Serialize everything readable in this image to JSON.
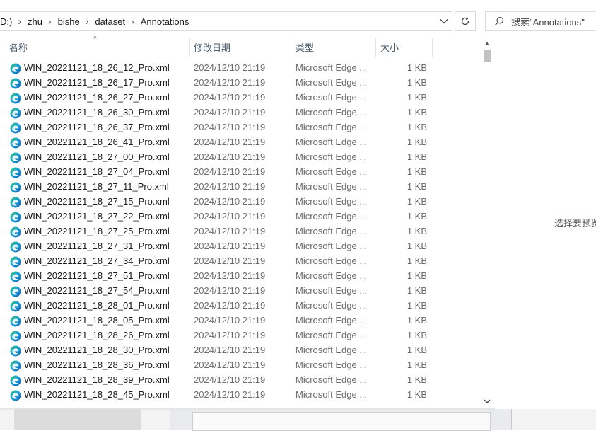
{
  "breadcrumb": {
    "drive_fragment": "D:)",
    "items": [
      "zhu",
      "bishe",
      "dataset",
      "Annotations"
    ]
  },
  "search": {
    "placeholder": "搜索\"Annotations\""
  },
  "columns": {
    "name": "名称",
    "date": "修改日期",
    "type": "类型",
    "size": "大小"
  },
  "files": [
    {
      "name": "WIN_20221121_18_26_12_Pro.xml",
      "date": "2024/12/10 21:19",
      "type": "Microsoft Edge ...",
      "size": "1 KB"
    },
    {
      "name": "WIN_20221121_18_26_17_Pro.xml",
      "date": "2024/12/10 21:19",
      "type": "Microsoft Edge ...",
      "size": "1 KB"
    },
    {
      "name": "WIN_20221121_18_26_27_Pro.xml",
      "date": "2024/12/10 21:19",
      "type": "Microsoft Edge ...",
      "size": "1 KB"
    },
    {
      "name": "WIN_20221121_18_26_30_Pro.xml",
      "date": "2024/12/10 21:19",
      "type": "Microsoft Edge ...",
      "size": "1 KB"
    },
    {
      "name": "WIN_20221121_18_26_37_Pro.xml",
      "date": "2024/12/10 21:19",
      "type": "Microsoft Edge ...",
      "size": "1 KB"
    },
    {
      "name": "WIN_20221121_18_26_41_Pro.xml",
      "date": "2024/12/10 21:19",
      "type": "Microsoft Edge ...",
      "size": "1 KB"
    },
    {
      "name": "WIN_20221121_18_27_00_Pro.xml",
      "date": "2024/12/10 21:19",
      "type": "Microsoft Edge ...",
      "size": "1 KB"
    },
    {
      "name": "WIN_20221121_18_27_04_Pro.xml",
      "date": "2024/12/10 21:19",
      "type": "Microsoft Edge ...",
      "size": "1 KB"
    },
    {
      "name": "WIN_20221121_18_27_11_Pro.xml",
      "date": "2024/12/10 21:19",
      "type": "Microsoft Edge ...",
      "size": "1 KB"
    },
    {
      "name": "WIN_20221121_18_27_15_Pro.xml",
      "date": "2024/12/10 21:19",
      "type": "Microsoft Edge ...",
      "size": "1 KB"
    },
    {
      "name": "WIN_20221121_18_27_22_Pro.xml",
      "date": "2024/12/10 21:19",
      "type": "Microsoft Edge ...",
      "size": "1 KB"
    },
    {
      "name": "WIN_20221121_18_27_25_Pro.xml",
      "date": "2024/12/10 21:19",
      "type": "Microsoft Edge ...",
      "size": "1 KB"
    },
    {
      "name": "WIN_20221121_18_27_31_Pro.xml",
      "date": "2024/12/10 21:19",
      "type": "Microsoft Edge ...",
      "size": "1 KB"
    },
    {
      "name": "WIN_20221121_18_27_34_Pro.xml",
      "date": "2024/12/10 21:19",
      "type": "Microsoft Edge ...",
      "size": "1 KB"
    },
    {
      "name": "WIN_20221121_18_27_51_Pro.xml",
      "date": "2024/12/10 21:19",
      "type": "Microsoft Edge ...",
      "size": "1 KB"
    },
    {
      "name": "WIN_20221121_18_27_54_Pro.xml",
      "date": "2024/12/10 21:19",
      "type": "Microsoft Edge ...",
      "size": "1 KB"
    },
    {
      "name": "WIN_20221121_18_28_01_Pro.xml",
      "date": "2024/12/10 21:19",
      "type": "Microsoft Edge ...",
      "size": "1 KB"
    },
    {
      "name": "WIN_20221121_18_28_05_Pro.xml",
      "date": "2024/12/10 21:19",
      "type": "Microsoft Edge ...",
      "size": "1 KB"
    },
    {
      "name": "WIN_20221121_18_28_26_Pro.xml",
      "date": "2024/12/10 21:19",
      "type": "Microsoft Edge ...",
      "size": "1 KB"
    },
    {
      "name": "WIN_20221121_18_28_30_Pro.xml",
      "date": "2024/12/10 21:19",
      "type": "Microsoft Edge ...",
      "size": "1 KB"
    },
    {
      "name": "WIN_20221121_18_28_36_Pro.xml",
      "date": "2024/12/10 21:19",
      "type": "Microsoft Edge ...",
      "size": "1 KB"
    },
    {
      "name": "WIN_20221121_18_28_39_Pro.xml",
      "date": "2024/12/10 21:19",
      "type": "Microsoft Edge ...",
      "size": "1 KB"
    },
    {
      "name": "WIN_20221121_18_28_45_Pro.xml",
      "date": "2024/12/10 21:19",
      "type": "Microsoft Edge ...",
      "size": "1 KB"
    }
  ],
  "preview": {
    "message": "选择要预览"
  },
  "icons": {
    "file": "edge-icon",
    "refresh": "refresh-icon",
    "search": "search-icon"
  },
  "colors": {
    "edge_blue": "#0c7fd6",
    "edge_green": "#3fc46a",
    "header_text": "#4a5a70"
  }
}
